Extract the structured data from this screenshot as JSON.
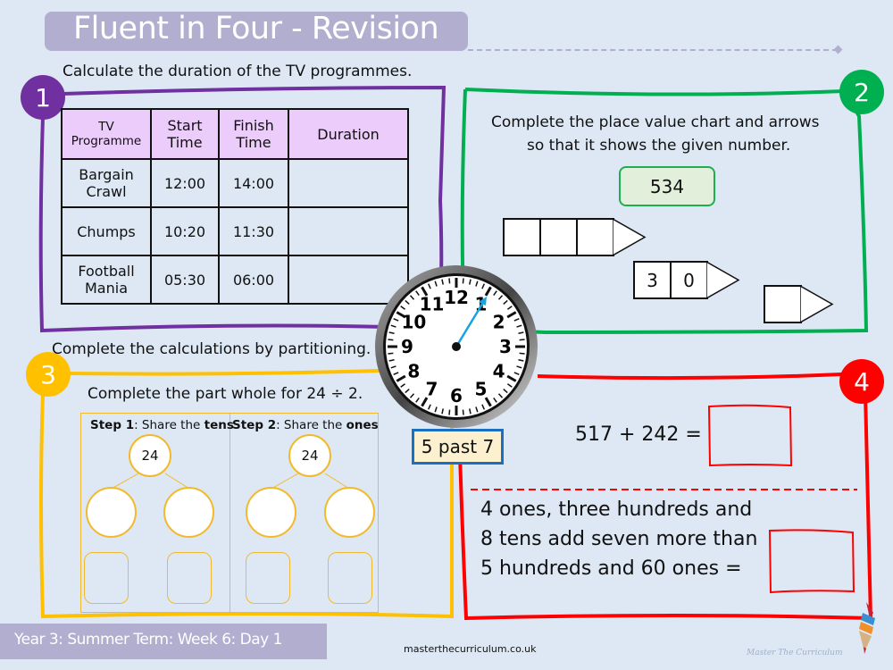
{
  "header": {
    "title": "Fluent in Four - Revision"
  },
  "colors": {
    "q1": "#7030a0",
    "q2": "#00b050",
    "q3": "#ffc000",
    "q4": "#ff0000",
    "title_bar": "#b1aed0",
    "background": "#dde8f4"
  },
  "q1": {
    "number": "1",
    "prompt": "Calculate the duration of the TV programmes.",
    "table": {
      "headers": [
        "TV Programme",
        "Start Time",
        "Finish Time",
        "Duration"
      ],
      "rows": [
        {
          "programme": "Bargain Crawl",
          "start": "12:00",
          "finish": "14:00",
          "duration": ""
        },
        {
          "programme": "Chumps",
          "start": "10:20",
          "finish": "11:30",
          "duration": ""
        },
        {
          "programme": "Football Mania",
          "start": "05:30",
          "finish": "06:00",
          "duration": ""
        }
      ]
    }
  },
  "q2": {
    "number": "2",
    "prompt_line1": "Complete the place value chart and arrows",
    "prompt_line2": "so that it shows the given number.",
    "given_number": "534",
    "hundreds_row": [
      "",
      "",
      ""
    ],
    "tens_row": [
      "3",
      "0"
    ],
    "ones_row": [
      ""
    ]
  },
  "clock": {
    "numbers": [
      "12",
      "1",
      "2",
      "3",
      "4",
      "5",
      "6",
      "7",
      "8",
      "9",
      "10",
      "11"
    ],
    "label": "5 past 7"
  },
  "q3": {
    "number": "3",
    "prompt": "Complete the calculations by partitioning.",
    "subprompt": "Complete the part whole for 24 ÷ 2.",
    "step1": {
      "label": "Step 1",
      "text": ": Share the ",
      "bold": "tens",
      "whole": "24"
    },
    "step2": {
      "label": "Step 2",
      "text": ": Share the ",
      "bold": "ones",
      "whole": "24"
    }
  },
  "q4": {
    "number": "4",
    "equation": "517 + 242 =",
    "line1": "4 ones, three hundreds and",
    "line2": "8 tens add seven more than",
    "line3": "5 hundreds and 60 ones ="
  },
  "footer": {
    "lesson": "Year 3: Summer Term: Week 6: Day 1",
    "website": "masterthecurriculum.co.uk",
    "logo_text": "Master  The  Curriculum"
  }
}
